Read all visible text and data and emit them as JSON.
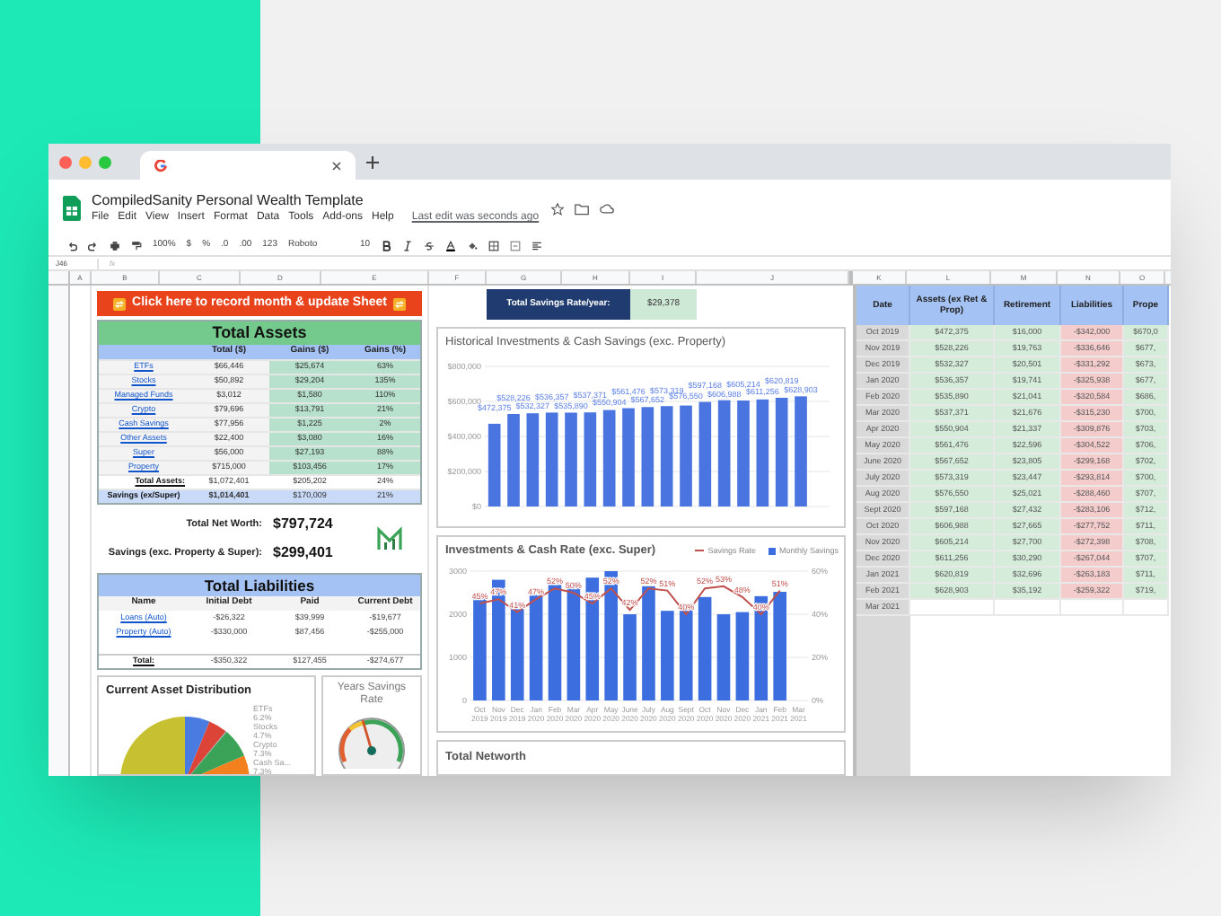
{
  "document": {
    "title": "CompiledSanity Personal Wealth Template",
    "menus": [
      "File",
      "Edit",
      "View",
      "Insert",
      "Format",
      "Data",
      "Tools",
      "Add-ons",
      "Help"
    ],
    "last_edit": "Last edit was seconds ago"
  },
  "toolbar": {
    "zoom": "100%",
    "currency": "$",
    "percent": "%",
    "decimal_decrease": ".0",
    "decimal_increase": ".00",
    "number_format": "123",
    "font": "Roboto",
    "font_size": "10"
  },
  "formula_bar": {
    "cell_ref": "J46",
    "fx": "fx"
  },
  "columns_left": [
    "A",
    "B",
    "C",
    "D",
    "E",
    "F",
    "G",
    "H",
    "I",
    "J"
  ],
  "columns_right": [
    "K",
    "L",
    "M",
    "N",
    "O"
  ],
  "banner": {
    "text": "Click here to record month & update Sheet"
  },
  "assets": {
    "title": "Total Assets",
    "columns": [
      "Total ($)",
      "Gains ($)",
      "Gains (%)"
    ],
    "rows": [
      {
        "kind": "link",
        "name": "ETFs",
        "total": "$66,446",
        "gains": "$25,674",
        "pct": "63%"
      },
      {
        "kind": "link",
        "name": "Stocks",
        "total": "$50,892",
        "gains": "$29,204",
        "pct": "135%"
      },
      {
        "kind": "link",
        "name": "Managed Funds",
        "total": "$3,012",
        "gains": "$1,580",
        "pct": "110%"
      },
      {
        "kind": "link",
        "name": "Crypto",
        "total": "$79,696",
        "gains": "$13,791",
        "pct": "21%"
      },
      {
        "kind": "link",
        "name": "Cash Savings",
        "total": "$77,956",
        "gains": "$1,225",
        "pct": "2%"
      },
      {
        "kind": "link",
        "name": "Other Assets",
        "total": "$22,400",
        "gains": "$3,080",
        "pct": "16%"
      },
      {
        "kind": "link",
        "name": "Super",
        "total": "$56,000",
        "gains": "$27,193",
        "pct": "88%"
      },
      {
        "kind": "link",
        "name": "Property",
        "total": "$715,000",
        "gains": "$103,456",
        "pct": "17%"
      },
      {
        "kind": "total",
        "name": "Total Assets:",
        "total": "$1,072,401",
        "gains": "$205,202",
        "pct": "24%"
      },
      {
        "kind": "savings",
        "name": "Savings (ex/Super)",
        "total": "$1,014,401",
        "gains": "$170,009",
        "pct": "21%"
      }
    ]
  },
  "summary": [
    {
      "label": "Total Net Worth:",
      "value": "$797,724"
    },
    {
      "label": "Savings (exc. Property & Super):",
      "value": "$299,401"
    }
  ],
  "liabilities": {
    "title": "Total Liabilities",
    "columns": [
      "Name",
      "Initial Debt",
      "Paid",
      "Current Debt"
    ],
    "rows": [
      {
        "kind": "link",
        "name": "Loans (Auto)",
        "initial": "-$26,322",
        "paid": "$39,999",
        "current": "-$19,677"
      },
      {
        "kind": "link",
        "name": "Property (Auto)",
        "initial": "-$330,000",
        "paid": "$87,456",
        "current": "-$255,000"
      },
      {
        "kind": "blank"
      },
      {
        "kind": "total",
        "name": "Total:",
        "initial": "-$350,322",
        "paid": "$127,455",
        "current": "-$274,677"
      }
    ]
  },
  "savings_rate": {
    "label": "Total Savings Rate/year:",
    "value": "$29,378"
  },
  "distribution": {
    "title": "Current Asset Distribution",
    "slice_labels": [
      {
        "name": "ETFs",
        "share": "6.2%"
      },
      {
        "name": "Stocks",
        "share": "4.7%"
      },
      {
        "name": "Crypto",
        "share": "7.3%"
      },
      {
        "name": "Cash Sa...",
        "share": "7.3%"
      }
    ]
  },
  "gauge": {
    "title": "Years Savings Rate"
  },
  "history_chart": {
    "chart_data": {
      "type": "bar",
      "title": "Historical Investments & Cash Savings (exc. Property)",
      "grid": true,
      "value_labels": [
        "$472,375",
        "$528,226",
        "$532,327",
        "$536,357",
        "$535,890",
        "$537,371",
        "$550,904",
        "$561,476",
        "$567,652",
        "$573,319",
        "$576,550",
        "$597,168",
        "$606,988",
        "$605,214",
        "$611,256",
        "$620,819",
        "$628,903",
        null
      ],
      "ylim": [
        0,
        800000
      ],
      "yticks": [
        {
          "value": 0,
          "label": "$0"
        },
        {
          "value": 200000,
          "label": "$200,000"
        },
        {
          "value": 400000,
          "label": "$400,000"
        },
        {
          "value": 600000,
          "label": "$600,000"
        },
        {
          "value": 800000,
          "label": "$800,000"
        }
      ],
      "values": [
        472375,
        528226,
        532327,
        536357,
        535890,
        537371,
        550904,
        561476,
        567652,
        573319,
        576550,
        597168,
        606988,
        605214,
        611256,
        620819,
        628903,
        null
      ]
    }
  },
  "rate_chart": {
    "right_axis_ticks": [
      "60%",
      "40%",
      "20%",
      "0%"
    ],
    "chart_data": {
      "type": "bar",
      "grid": true,
      "title": "Investments & Cash Rate (exc. Super)",
      "categories": [
        "Oct 2019",
        "Nov 2019",
        "Dec 2019",
        "Jan 2020",
        "Feb 2020",
        "Mar 2020",
        "Apr 2020",
        "May 2020",
        "June 2020",
        "July 2020",
        "Aug 2020",
        "Sept 2020",
        "Oct 2020",
        "Nov 2020",
        "Dec 2020",
        "Jan 2021",
        "Feb 2021",
        "Mar 2021"
      ],
      "ylim": [
        0,
        3000
      ],
      "yticks": [
        0,
        1000,
        2000,
        3000
      ],
      "series": [
        {
          "name": "Savings Rate",
          "color": "#c0504d",
          "type": "line",
          "axis": "y2",
          "value_labels": [
            "45%",
            "47%",
            "41%",
            "47%",
            "52%",
            "50%",
            "45%",
            "52%",
            "42%",
            "52%",
            "51%",
            "40%",
            "52%",
            "53%",
            "48%",
            "40%",
            "51%",
            null
          ],
          "values": [
            45,
            47,
            41,
            47,
            52,
            50,
            45,
            52,
            42,
            52,
            51,
            40,
            52,
            53,
            48,
            40,
            51,
            null
          ]
        },
        {
          "name": "Monthly Savings",
          "color": "#3d6ee0",
          "type": "bar",
          "values": [
            2400,
            2800,
            2250,
            2450,
            2680,
            2750,
            2850,
            3000,
            2000,
            2650,
            2080,
            2250,
            2400,
            2000,
            2050,
            2420,
            2520,
            null
          ]
        }
      ]
    }
  },
  "networth_chart": {
    "title": "Total Networth"
  },
  "history_table": {
    "columns": [
      "Date",
      "Assets (ex Ret & Prop)",
      "Retirement",
      "Liabilities",
      "Prope"
    ],
    "rows": [
      {
        "date": "Oct 2019",
        "assets": "$472,375",
        "retirement": "$16,000",
        "liabilities": "-$342,000",
        "property": "$670,0"
      },
      {
        "date": "Nov 2019",
        "assets": "$528,226",
        "retirement": "$19,763",
        "liabilities": "-$336,646",
        "property": "$677,"
      },
      {
        "date": "Dec 2019",
        "assets": "$532,327",
        "retirement": "$20,501",
        "liabilities": "-$331,292",
        "property": "$673,"
      },
      {
        "date": "Jan 2020",
        "assets": "$536,357",
        "retirement": "$19,741",
        "liabilities": "-$325,938",
        "property": "$677,"
      },
      {
        "date": "Feb 2020",
        "assets": "$535,890",
        "retirement": "$21,041",
        "liabilities": "-$320,584",
        "property": "$686,"
      },
      {
        "date": "Mar 2020",
        "assets": "$537,371",
        "retirement": "$21,676",
        "liabilities": "-$315,230",
        "property": "$700,"
      },
      {
        "date": "Apr 2020",
        "assets": "$550,904",
        "retirement": "$21,337",
        "liabilities": "-$309,876",
        "property": "$703,"
      },
      {
        "date": "May 2020",
        "assets": "$561,476",
        "retirement": "$22,596",
        "liabilities": "-$304,522",
        "property": "$706,"
      },
      {
        "date": "June 2020",
        "assets": "$567,652",
        "retirement": "$23,805",
        "liabilities": "-$299,168",
        "property": "$702,"
      },
      {
        "date": "July 2020",
        "assets": "$573,319",
        "retirement": "$23,447",
        "liabilities": "-$293,814",
        "property": "$700,"
      },
      {
        "date": "Aug 2020",
        "assets": "$576,550",
        "retirement": "$25,021",
        "liabilities": "-$288,460",
        "property": "$707,"
      },
      {
        "date": "Sept 2020",
        "assets": "$597,168",
        "retirement": "$27,432",
        "liabilities": "-$283,106",
        "property": "$712,"
      },
      {
        "date": "Oct 2020",
        "assets": "$606,988",
        "retirement": "$27,665",
        "liabilities": "-$277,752",
        "property": "$711,"
      },
      {
        "date": "Nov 2020",
        "assets": "$605,214",
        "retirement": "$27,700",
        "liabilities": "-$272,398",
        "property": "$708,"
      },
      {
        "date": "Dec 2020",
        "assets": "$611,256",
        "retirement": "$30,290",
        "liabilities": "-$267,044",
        "property": "$707,"
      },
      {
        "date": "Jan 2021",
        "assets": "$620,819",
        "retirement": "$32,696",
        "liabilities": "-$263,183",
        "property": "$711,"
      },
      {
        "date": "Feb 2021",
        "assets": "$628,903",
        "retirement": "$35,192",
        "liabilities": "-$259,322",
        "property": "$719,"
      },
      {
        "date": "Mar 2021"
      }
    ]
  }
}
